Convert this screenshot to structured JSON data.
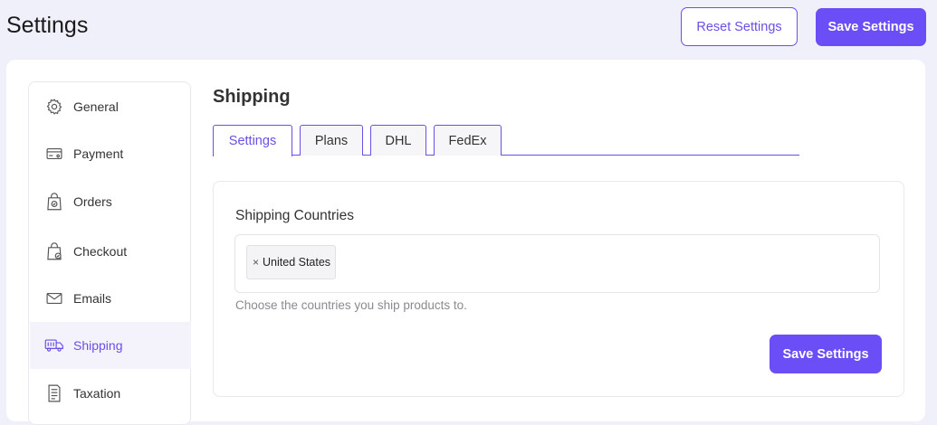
{
  "header": {
    "title": "Settings",
    "reset_label": "Reset Settings",
    "save_label": "Save Settings"
  },
  "sidebar": {
    "items": [
      {
        "label": "General",
        "icon": "gear-icon",
        "active": false
      },
      {
        "label": "Payment",
        "icon": "credit-card-icon",
        "active": false
      },
      {
        "label": "Orders",
        "icon": "shopping-bag-check-icon",
        "active": false
      },
      {
        "label": "Checkout",
        "icon": "bag-check-icon",
        "active": false
      },
      {
        "label": "Emails",
        "icon": "envelope-icon",
        "active": false
      },
      {
        "label": "Shipping",
        "icon": "truck-icon",
        "active": true
      },
      {
        "label": "Taxation",
        "icon": "receipt-icon",
        "active": false
      }
    ]
  },
  "main": {
    "section_title": "Shipping",
    "tabs": [
      {
        "label": "Settings",
        "active": true
      },
      {
        "label": "Plans",
        "active": false
      },
      {
        "label": "DHL",
        "active": false
      },
      {
        "label": "FedEx",
        "active": false
      }
    ],
    "field_label": "Shipping Countries",
    "selected_countries": [
      "United States"
    ],
    "remove_glyph": "×",
    "help_text": "Choose the countries you ship products to.",
    "save_label": "Save Settings"
  },
  "colors": {
    "accent": "#6b4ef5",
    "background": "#f0f0fb",
    "active_item_bg": "#f4f3fc"
  }
}
